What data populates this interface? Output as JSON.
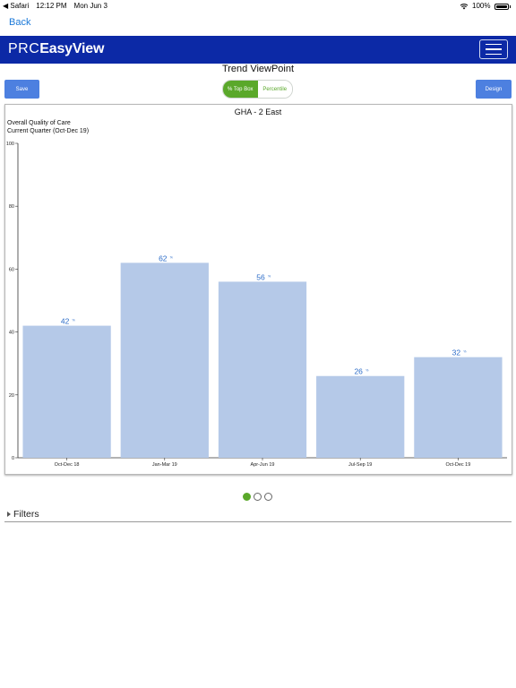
{
  "status_bar": {
    "back_app": "Safari",
    "time": "12:12 PM",
    "date": "Mon Jun 3",
    "battery": "100%"
  },
  "nav": {
    "back_label": "Back"
  },
  "header": {
    "logo_prefix": "PRC",
    "logo_main": "EasyView"
  },
  "page": {
    "title": "Trend ViewPoint"
  },
  "toolbar": {
    "save_label": "Save",
    "design_label": "Design",
    "toggle": {
      "options": [
        "% Top Box",
        "Percentile"
      ],
      "selected": "% Top Box"
    }
  },
  "pager": {
    "total": 3,
    "current": 1
  },
  "filters": {
    "label": "Filters"
  },
  "colors": {
    "brand": "#0c29a6",
    "accent_green": "#5aa82a",
    "bar_fill": "#b5c9e8",
    "button_blue": "#4d80e0",
    "label_blue": "#2c6cc8"
  },
  "chart_data": {
    "type": "bar",
    "title": "GHA - 2 East",
    "subtitle_lines": [
      "Overall Quality of Care",
      "Current Quarter (Oct-Dec 19)"
    ],
    "categories": [
      "Oct-Dec 18",
      "Jan-Mar 19",
      "Apr-Jun 19",
      "Jul-Sep 19",
      "Oct-Dec 19"
    ],
    "values": [
      42,
      62,
      56,
      26,
      32
    ],
    "value_suffix": "%",
    "ylim": [
      0,
      100
    ],
    "yticks": [
      0,
      20,
      40,
      60,
      80,
      100
    ],
    "grid": false,
    "xlabel": "",
    "ylabel": ""
  }
}
